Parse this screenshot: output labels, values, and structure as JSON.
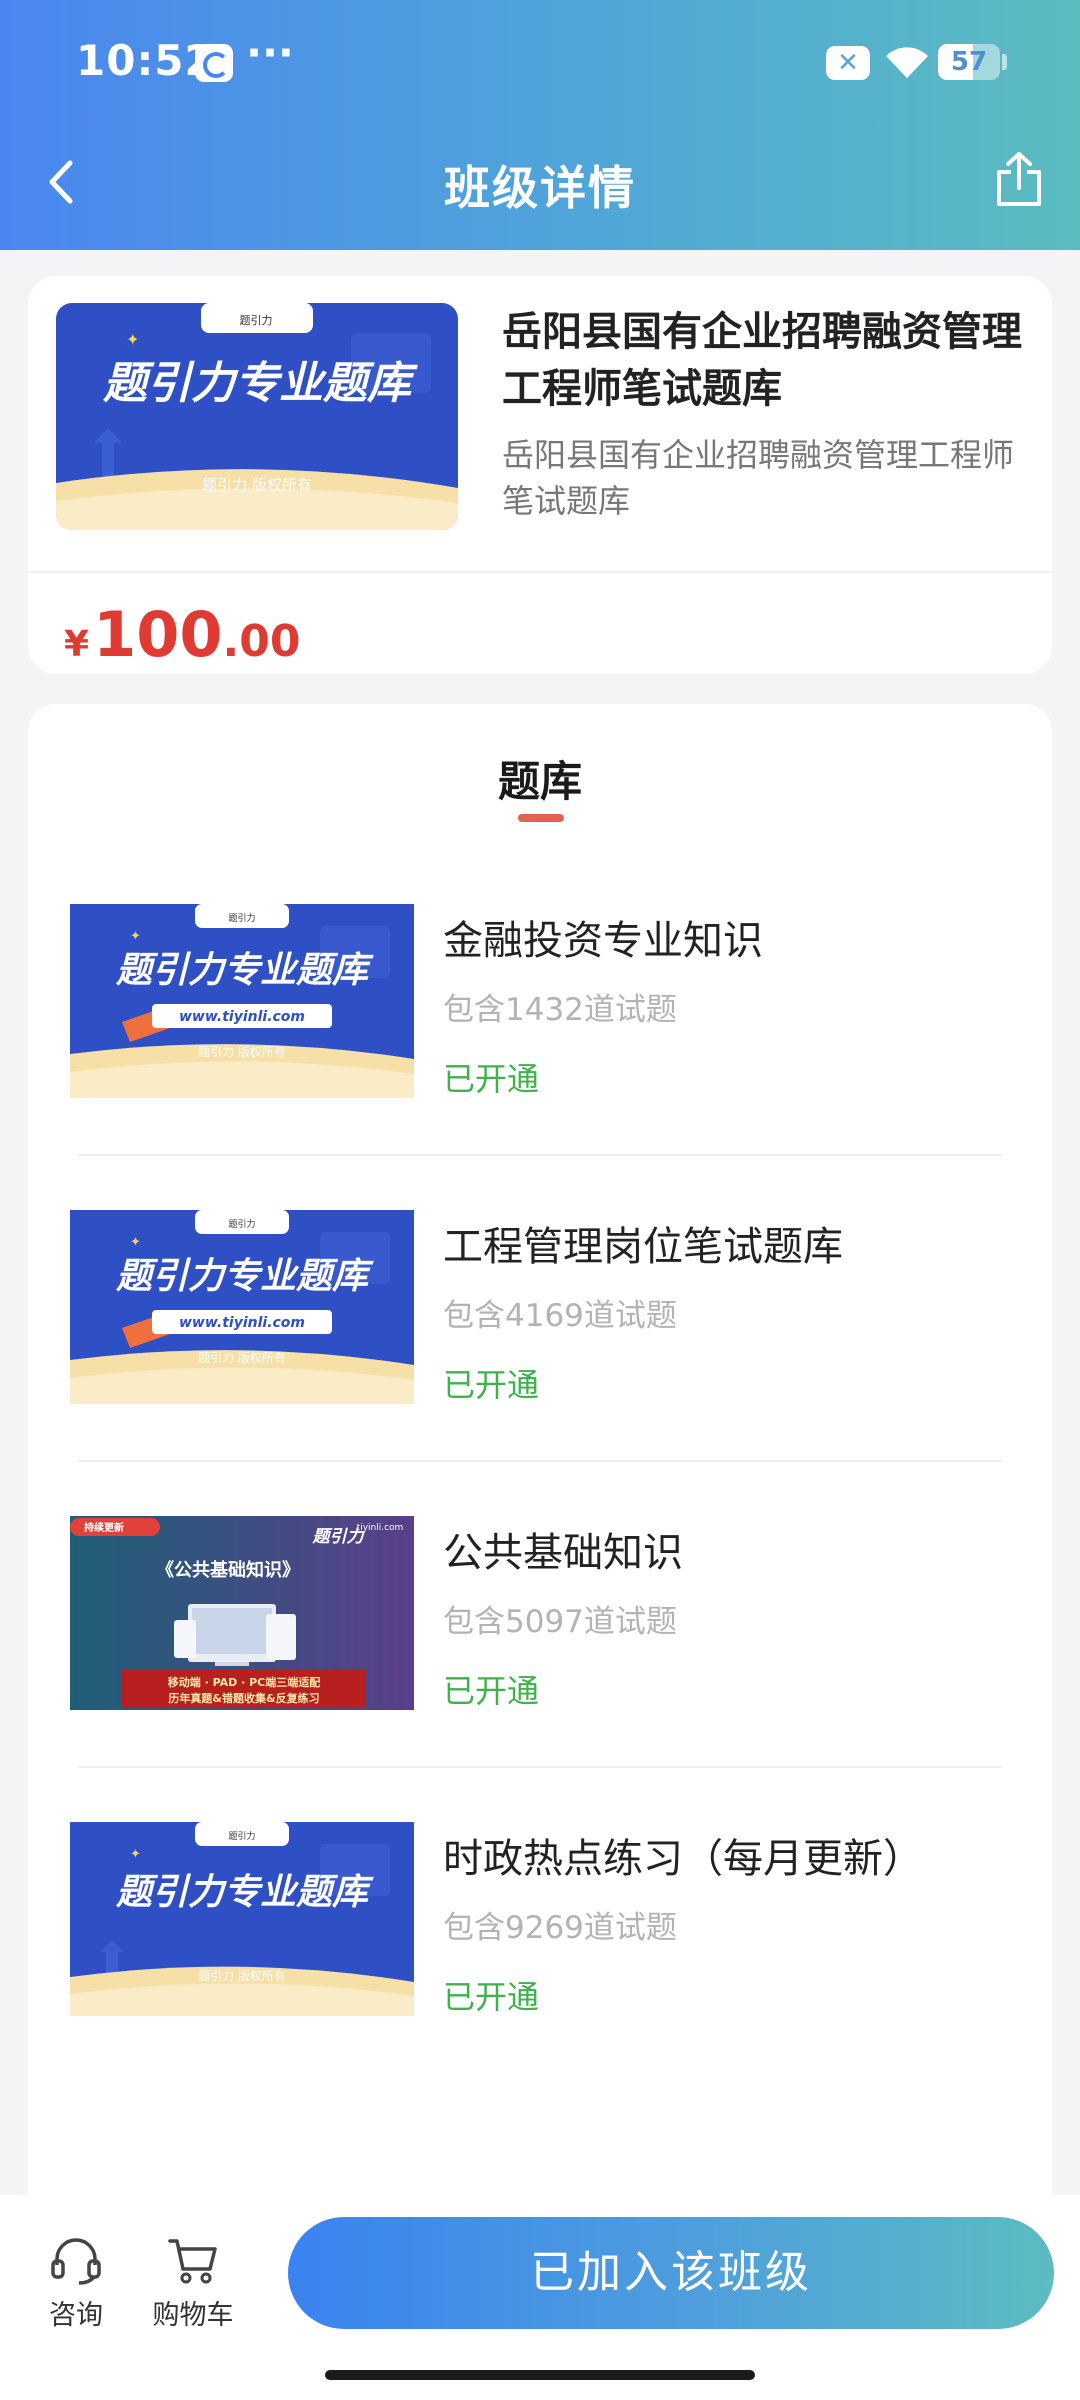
{
  "status_bar": {
    "time": "10:52",
    "dots": "···",
    "battery_level": "57",
    "battery_fraction": 0.57
  },
  "nav": {
    "title": "班级详情",
    "back_icon": "chevron-left-icon",
    "share_icon": "share-icon"
  },
  "class_info": {
    "title": "岳阳县国有企业招聘融资管理工程师笔试题库",
    "description": "岳阳县国有企业招聘融资管理工程师笔试题库",
    "cover": {
      "headline": "题引力专业题库",
      "footer": "题引力 版权所有",
      "badge": "题引力"
    },
    "price": {
      "currency": "¥",
      "integer": "100",
      "decimal": ".00"
    }
  },
  "bank_section": {
    "tab_label": "题库",
    "items": [
      {
        "name": "金融投资专业知识",
        "count": "包含1432道试题",
        "status": "已开通",
        "thumb": {
          "headline": "题引力专业题库",
          "url": "www.tiyinli.com",
          "footer": "题引力 版权所有",
          "badge": "题引力"
        }
      },
      {
        "name": "工程管理岗位笔试题库",
        "count": "包含4169道试题",
        "status": "已开通",
        "thumb": {
          "headline": "题引力专业题库",
          "url": "www.tiyinli.com",
          "footer": "题引力 版权所有",
          "badge": "题引力"
        }
      },
      {
        "name": "公共基础知识",
        "count": "包含5097道试题",
        "status": "已开通",
        "thumb": {
          "tag": "持续更新",
          "brand": "题引力",
          "site": "tiyinli.com",
          "headline": "《公共基础知识》",
          "line1": "移动端 · PAD · PC端三端适配",
          "line2": "历年真题&错题收集&反复练习"
        }
      },
      {
        "name": "时政热点练习（每月更新）",
        "count": "包含9269道试题",
        "status": "已开通",
        "thumb": {
          "headline": "题引力专业题库",
          "footer": "题引力 版权所有",
          "badge": "题引力"
        }
      }
    ]
  },
  "bottom_bar": {
    "consult_label": "咨询",
    "cart_label": "购物车",
    "join_label": "已加入该班级"
  },
  "colors": {
    "header_start": "#4a86f0",
    "header_end": "#5bbcc0",
    "price": "#e03b33",
    "status_open": "#3fb24c",
    "tab_underline": "#e5614f",
    "cover_blue": "#2f4fc4"
  }
}
